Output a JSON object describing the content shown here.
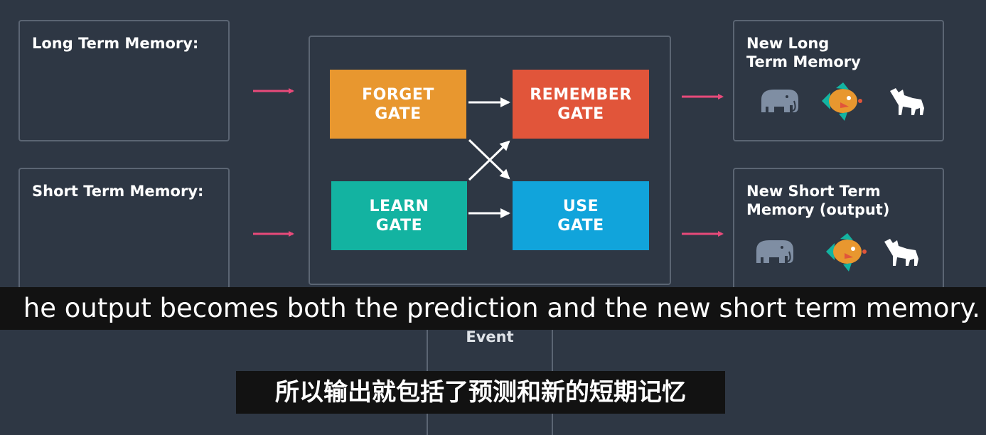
{
  "inputs": {
    "long_term": "Long Term Memory:",
    "short_term": "Short Term Memory:"
  },
  "gates": {
    "forget": "FORGET\nGATE",
    "remember": "REMEMBER\nGATE",
    "learn": "LEARN\nGATE",
    "use": "USE\nGATE"
  },
  "outputs": {
    "new_long_term": "New Long\nTerm Memory",
    "new_short_term": "New Short Term\nMemory (output)"
  },
  "event_label": "Event",
  "subtitles": {
    "english": "he output becomes both the prediction and the new short term memory.",
    "chinese": "所以输出就包括了预测和新的短期记忆"
  },
  "icons": [
    "elephant-icon",
    "fish-icon",
    "wolf-icon"
  ],
  "colors": {
    "background": "#2e3744",
    "forget_gate": "#e8972f",
    "remember_gate": "#e1553a",
    "learn_gate": "#13b3a1",
    "use_gate": "#11a4db",
    "input_arrow": "#e84a7a",
    "subtitle_bg": "#121212"
  }
}
